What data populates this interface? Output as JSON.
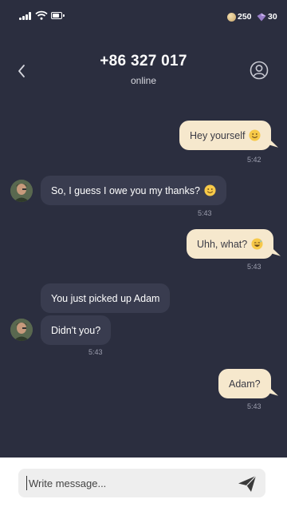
{
  "status_bar": {
    "coins": "250",
    "gems": "30"
  },
  "header": {
    "contact_name": "+86 327 017",
    "status": "online"
  },
  "messages": [
    {
      "direction": "out",
      "text": "Hey yourself",
      "emoji": "slightly-smiling-face",
      "time": "5:42"
    },
    {
      "direction": "in",
      "text": "So, I guess I owe you my thanks?",
      "emoji": "slightly-smiling-face",
      "time": "5:43"
    },
    {
      "direction": "out",
      "text": "Uhh, what?",
      "emoji": "grinning-sweat-face",
      "time": "5:43"
    },
    {
      "direction": "in",
      "text": "You just picked up Adam",
      "time": ""
    },
    {
      "direction": "in",
      "text": "Didn't you?",
      "time": "5:43"
    },
    {
      "direction": "out",
      "text": "Adam?",
      "time": "5:43"
    }
  ],
  "composer": {
    "placeholder": "Write message..."
  },
  "colors": {
    "background": "#2b2e3f",
    "outgoing_bubble": "#f6e8cd",
    "incoming_bubble": "#393c4f"
  }
}
